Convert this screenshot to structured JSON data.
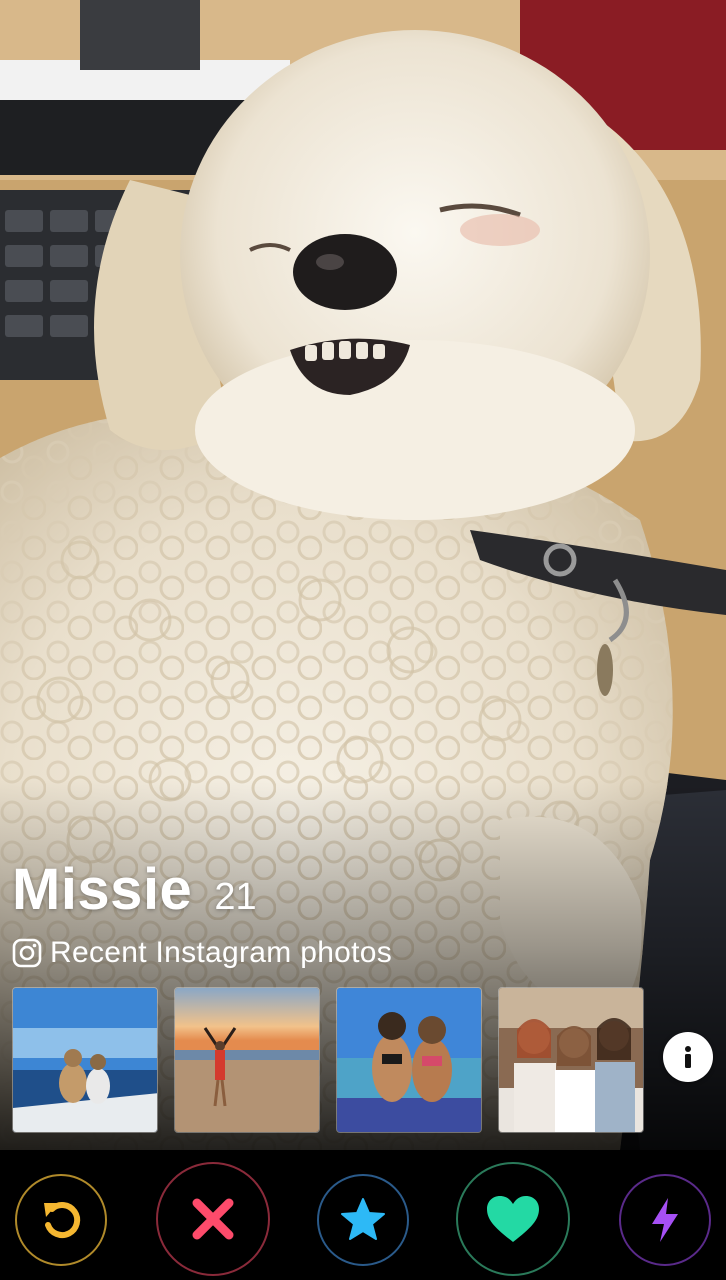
{
  "profile": {
    "name": "Missie",
    "age": "21",
    "photo_subject": "white-fluffy-dog"
  },
  "instagram": {
    "label": "Recent Instagram photos",
    "icon": "instagram-icon",
    "thumbnails": [
      {
        "icon": "beach-boat-photo"
      },
      {
        "icon": "sunset-beach-photo"
      },
      {
        "icon": "friends-boat-photo"
      },
      {
        "icon": "friends-group-photo"
      }
    ]
  },
  "info_button": {
    "icon": "info-icon"
  },
  "actions": [
    {
      "name": "rewind",
      "icon": "rewind-icon",
      "color": "#f5b731"
    },
    {
      "name": "nope",
      "icon": "close-icon",
      "color": "#fd4b6b"
    },
    {
      "name": "super-like",
      "icon": "star-icon",
      "color": "#2db9f6"
    },
    {
      "name": "like",
      "icon": "heart-icon",
      "color": "#23d9a4"
    },
    {
      "name": "boost",
      "icon": "lightning-icon",
      "color": "#a650f5"
    }
  ]
}
